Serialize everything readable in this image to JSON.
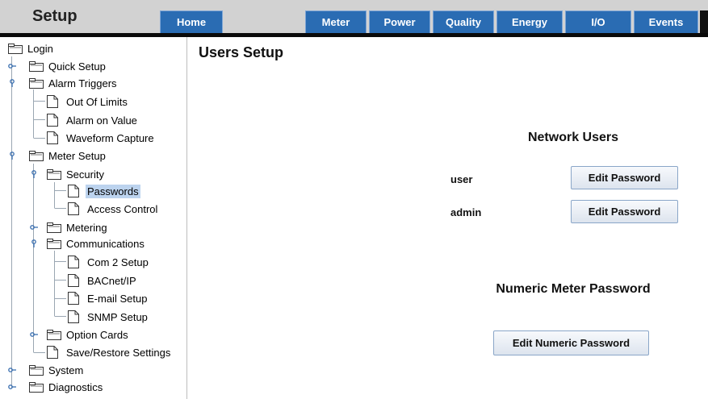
{
  "header": {
    "title": "Setup"
  },
  "nav": {
    "tabs": [
      {
        "label": "Home"
      },
      {
        "label": "Meter"
      },
      {
        "label": "Power"
      },
      {
        "label": "Quality"
      },
      {
        "label": "Energy"
      },
      {
        "label": "I/O"
      },
      {
        "label": "Events"
      }
    ]
  },
  "tree": {
    "login": "Login",
    "quick_setup": "Quick Setup",
    "alarm_triggers": "Alarm Triggers",
    "out_of_limits": "Out Of Limits",
    "alarm_on_value": "Alarm on Value",
    "waveform_capture": "Waveform Capture",
    "meter_setup": "Meter Setup",
    "security": "Security",
    "passwords": "Passwords",
    "access_control": "Access Control",
    "metering": "Metering",
    "communications": "Communications",
    "com2_setup": "Com 2 Setup",
    "bacnet_ip": "BACnet/IP",
    "email_setup": "E-mail Setup",
    "snmp_setup": "SNMP Setup",
    "option_cards": "Option Cards",
    "save_restore": "Save/Restore Settings",
    "system": "System",
    "diagnostics": "Diagnostics"
  },
  "main": {
    "title": "Users Setup",
    "network_users": {
      "heading": "Network Users",
      "users": [
        {
          "name": "user",
          "button": "Edit Password"
        },
        {
          "name": "admin",
          "button": "Edit Password"
        }
      ]
    },
    "numeric": {
      "heading": "Numeric Meter Password",
      "button": "Edit Numeric Password"
    }
  },
  "colors": {
    "tab_blue": "#2a6cb3",
    "selection": "#bcd3ee",
    "header_gray": "#d2d2d2"
  },
  "icons": {
    "folder": "folder-icon",
    "document": "document-icon",
    "expanded": "expanded-toggle-icon",
    "collapsed": "collapsed-toggle-icon"
  }
}
